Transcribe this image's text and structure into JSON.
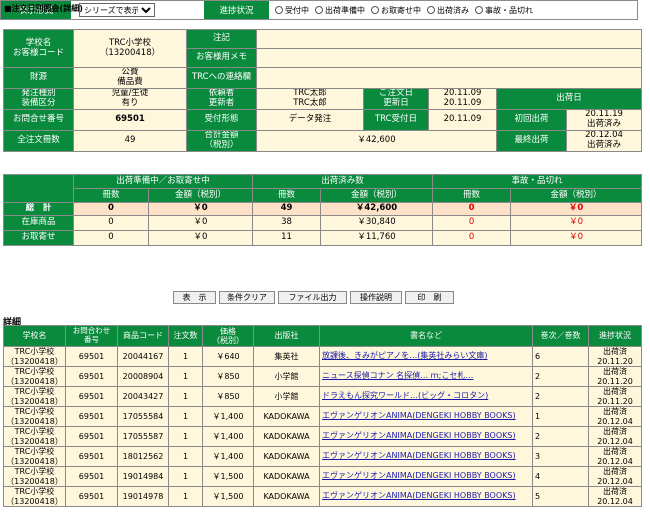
{
  "page_title": "■注文日別照会(詳細)",
  "info": {
    "school_label": "学校名\nお客様コード",
    "school_value": "TRC小学校\n（13200418）",
    "note_label": "注記",
    "note_value": "",
    "customer_memo_label": "お客様用メモ",
    "customer_memo_value": "",
    "zaigen_label": "財源",
    "zaigen_value": "公費\n備品費",
    "trc_contact_label": "TRCへの連絡欄",
    "trc_contact_value": "",
    "order_type_label": "発注種別\n装備区分",
    "order_type_value": "児童/生徒\n有り",
    "requester_label": "依頼者\n更新者",
    "requester_value": "TRC太郎\nTRC太郎",
    "order_date_label": "ご注文日\n更新日",
    "order_date_value": "20.11.09\n20.11.09",
    "ship_date_label": "出荷日",
    "inquiry_label": "お問合せ番号",
    "inquiry_value": "69501",
    "reception_label": "受付形態",
    "reception_value": "データ発注",
    "trc_received_label": "TRC受付日",
    "trc_received_value": "20.11.09",
    "first_ship_label": "初回出荷",
    "first_ship_value": "20.11.19\n出荷済み",
    "total_qty_label": "全注文冊数",
    "total_qty_value": "49",
    "total_amount_label": "合計金額\n（税別）",
    "total_amount_value": "￥42,600",
    "last_ship_label": "最終出荷",
    "last_ship_value": "20.12.04\n出荷済み"
  },
  "summary": {
    "head_preparing": "出荷準備中／お取寄せ中",
    "head_shipped": "出荷済み数",
    "head_accident": "事故・品切れ",
    "sub_qty": "冊数",
    "sub_amount": "金額（税別）",
    "rows": [
      {
        "label": "総　計",
        "p_qty": "0",
        "p_amt": "￥0",
        "s_qty": "49",
        "s_amt": "￥42,600",
        "a_qty": "0",
        "a_amt": "￥0"
      },
      {
        "label": "在庫商品",
        "p_qty": "0",
        "p_amt": "￥0",
        "s_qty": "38",
        "s_amt": "￥30,840",
        "a_qty": "0",
        "a_amt": "￥0"
      },
      {
        "label": "お取寄せ",
        "p_qty": "0",
        "p_amt": "￥0",
        "s_qty": "11",
        "s_amt": "￥11,760",
        "a_qty": "0",
        "a_amt": "￥0"
      }
    ]
  },
  "filter": {
    "display_label": "表示形式",
    "display_value": "シリーズで表示",
    "progress_label": "進捗状況",
    "options": [
      "受付中",
      "出荷準備中",
      "お取寄せ中",
      "出荷済み",
      "事故・品切れ"
    ]
  },
  "buttons": [
    "表　示",
    "条件クリア",
    "ファイル出力",
    "操作説明",
    "印　刷"
  ],
  "detail_title": "詳細",
  "detail": {
    "headers": [
      "学校名",
      "お問合わせ\n番号",
      "商品コード",
      "注文数",
      "価格\n（税別）",
      "出版社",
      "書名など",
      "巻次／巻数",
      "進捗状況"
    ],
    "rows": [
      {
        "school": "TRC小学校\n（13200418）",
        "inquiry": "69501",
        "code": "20044167",
        "qty": "1",
        "price": "￥640",
        "publisher": "集英社",
        "title": "放課後、きみがピアノを…(集英社みらい文庫)",
        "vol": "6",
        "status": "出荷済\n20.11.20"
      },
      {
        "school": "TRC小学校\n（13200418）",
        "inquiry": "69501",
        "code": "20008904",
        "qty": "1",
        "price": "￥850",
        "publisher": "小学館",
        "title": "ニュース探偵コナン 名探偵… ｍ;こセ札…",
        "vol": "2",
        "status": "出荷済\n20.11.20"
      },
      {
        "school": "TRC小学校\n（13200418）",
        "inquiry": "69501",
        "code": "20043427",
        "qty": "1",
        "price": "￥850",
        "publisher": "小学館",
        "title": "ドラえもん探究ワールド…(ビッグ・コロタン)",
        "vol": "2",
        "status": "出荷済\n20.11.20"
      },
      {
        "school": "TRC小学校\n（13200418）",
        "inquiry": "69501",
        "code": "17055584",
        "qty": "1",
        "price": "￥1,400",
        "publisher": "KADOKAWA",
        "title": "エヴァンゲリオンANIMA(DENGEKI HOBBY BOOKS)",
        "vol": "1",
        "status": "出荷済\n20.12.04"
      },
      {
        "school": "TRC小学校\n（13200418）",
        "inquiry": "69501",
        "code": "17055587",
        "qty": "1",
        "price": "￥1,400",
        "publisher": "KADOKAWA",
        "title": "エヴァンゲリオンANIMA(DENGEKI HOBBY BOOKS)",
        "vol": "2",
        "status": "出荷済\n20.12.04"
      },
      {
        "school": "TRC小学校\n（13200418）",
        "inquiry": "69501",
        "code": "18012562",
        "qty": "1",
        "price": "￥1,400",
        "publisher": "KADOKAWA",
        "title": "エヴァンゲリオンANIMA(DENGEKI HOBBY BOOKS)",
        "vol": "3",
        "status": "出荷済\n20.12.04"
      },
      {
        "school": "TRC小学校\n（13200418）",
        "inquiry": "69501",
        "code": "19014984",
        "qty": "1",
        "price": "￥1,500",
        "publisher": "KADOKAWA",
        "title": "エヴァンゲリオンANIMA(DENGEKI HOBBY BOOKS)",
        "vol": "4",
        "status": "出荷済\n20.12.04"
      },
      {
        "school": "TRC小学校\n（13200418）",
        "inquiry": "69501",
        "code": "19014978",
        "qty": "1",
        "price": "￥1,500",
        "publisher": "KADOKAWA",
        "title": "エヴァンゲリオンANIMA(DENGEKI HOBBY BOOKS)",
        "vol": "5",
        "status": "出荷済\n20.12.04"
      }
    ]
  }
}
